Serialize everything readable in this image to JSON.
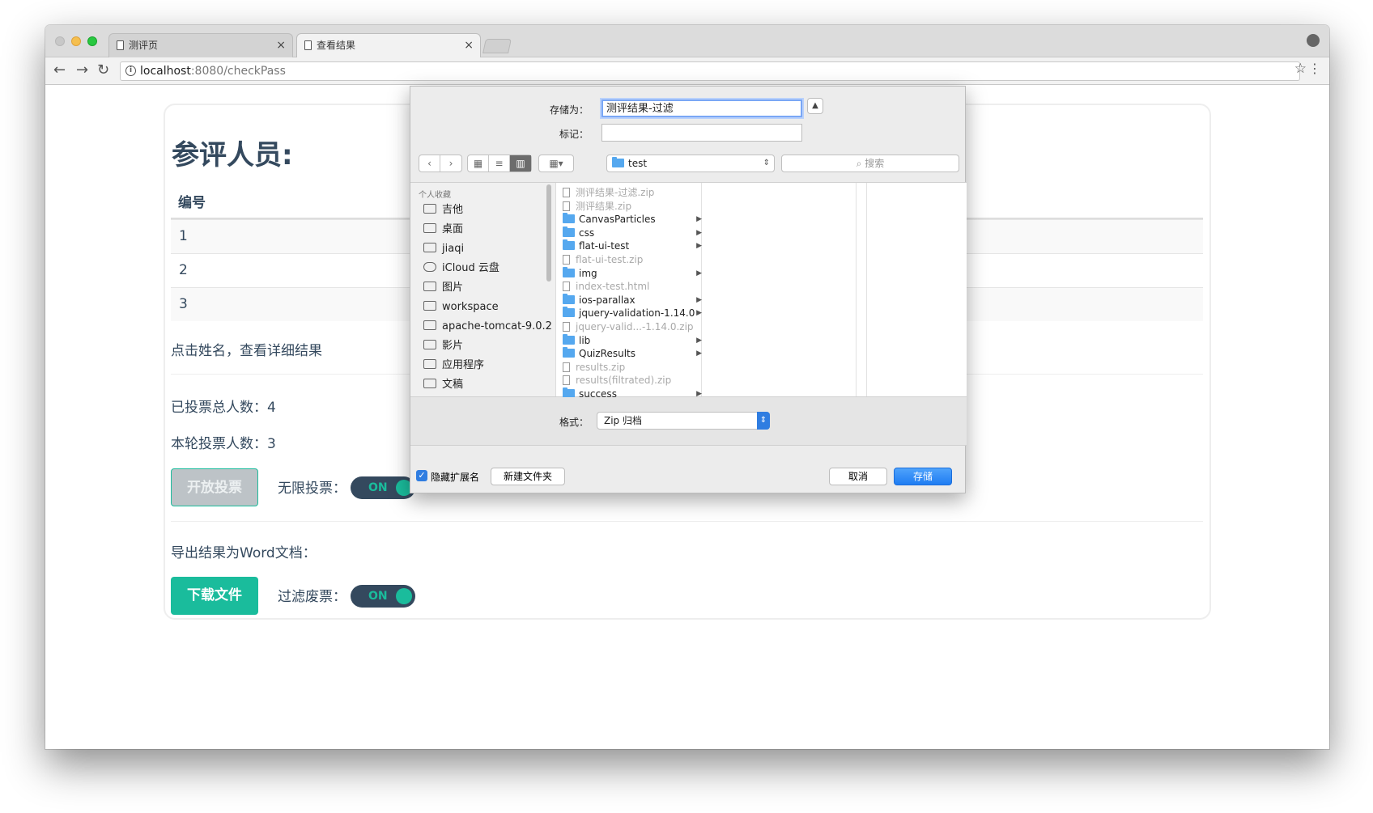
{
  "browser": {
    "tabs": [
      {
        "label": "测评页"
      },
      {
        "label": "查看结果"
      }
    ],
    "url_host": "localhost",
    "url_path": ":8080/checkPass"
  },
  "page": {
    "title": "参评人员:",
    "table_header": "编号",
    "rows": [
      "1",
      "2",
      "3"
    ],
    "hint": "点击姓名，查看详细结果",
    "total_voted": "已投票总人数：4",
    "round_voted": "本轮投票人数：3",
    "open_vote_label": "开放投票",
    "unlimited_label": "无限投票：",
    "switch_on": "ON",
    "export_label": "导出结果为Word文档：",
    "download_label": "下载文件",
    "filter_label": "过滤废票："
  },
  "dialog": {
    "save_as_label": "存储为：",
    "save_as_value": "测评结果-过滤",
    "tags_label": "标记：",
    "location": "test",
    "search_placeholder": "搜索",
    "sidebar_header": "个人收藏",
    "sidebar_items": [
      "吉他",
      "桌面",
      "jiaqi",
      "iCloud 云盘",
      "图片",
      "workspace",
      "apache-tomcat-9.0.2",
      "影片",
      "应用程序",
      "文稿"
    ],
    "files": [
      {
        "name": "测评结果-过滤.zip",
        "kind": "file",
        "dim": true
      },
      {
        "name": "测评结果.zip",
        "kind": "file",
        "dim": true
      },
      {
        "name": "CanvasParticles",
        "kind": "folder",
        "dim": false
      },
      {
        "name": "css",
        "kind": "folder",
        "dim": false
      },
      {
        "name": "flat-ui-test",
        "kind": "folder",
        "dim": false
      },
      {
        "name": "flat-ui-test.zip",
        "kind": "file",
        "dim": true
      },
      {
        "name": "img",
        "kind": "folder",
        "dim": false
      },
      {
        "name": "index-test.html",
        "kind": "file",
        "dim": true
      },
      {
        "name": "ios-parallax",
        "kind": "folder",
        "dim": false
      },
      {
        "name": "jquery-validation-1.14.0",
        "kind": "folder",
        "dim": false
      },
      {
        "name": "jquery-valid...-1.14.0.zip",
        "kind": "file",
        "dim": true
      },
      {
        "name": "lib",
        "kind": "folder",
        "dim": false
      },
      {
        "name": "QuizResults",
        "kind": "folder",
        "dim": false
      },
      {
        "name": "results.zip",
        "kind": "file",
        "dim": true
      },
      {
        "name": "results(filtrated).zip",
        "kind": "file",
        "dim": true
      },
      {
        "name": "success",
        "kind": "folder",
        "dim": false
      }
    ],
    "format_label": "格式：",
    "format_value": "Zip 归档",
    "hide_ext_label": "隐藏扩展名",
    "new_folder_label": "新建文件夹",
    "cancel_label": "取消",
    "save_label": "存储"
  },
  "colors": {
    "accent": "#1abc9c",
    "text": "#34495e",
    "dialog_blue": "#1e7cf2"
  }
}
